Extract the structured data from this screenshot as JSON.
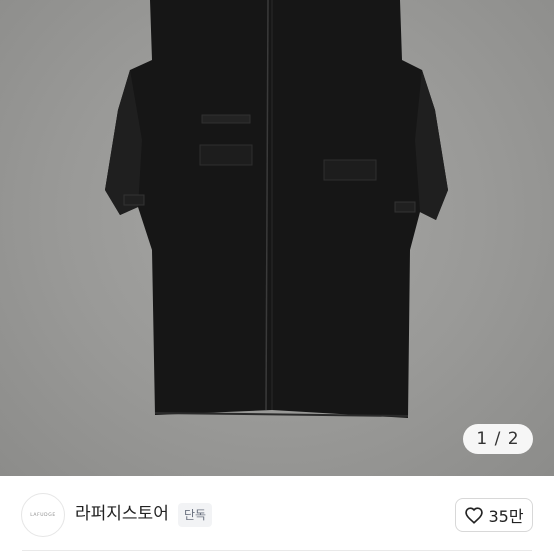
{
  "gallery": {
    "image_counter": "1 / 2"
  },
  "seller": {
    "logo_text": "LAFUDGE",
    "name": "라퍼지스토어",
    "badge": "단독"
  },
  "like": {
    "icon": "heart-icon",
    "count": "35만"
  },
  "colors": {
    "background": "#ffffff",
    "hero_backdrop": "#9d9d9b",
    "coat": "#151515"
  }
}
